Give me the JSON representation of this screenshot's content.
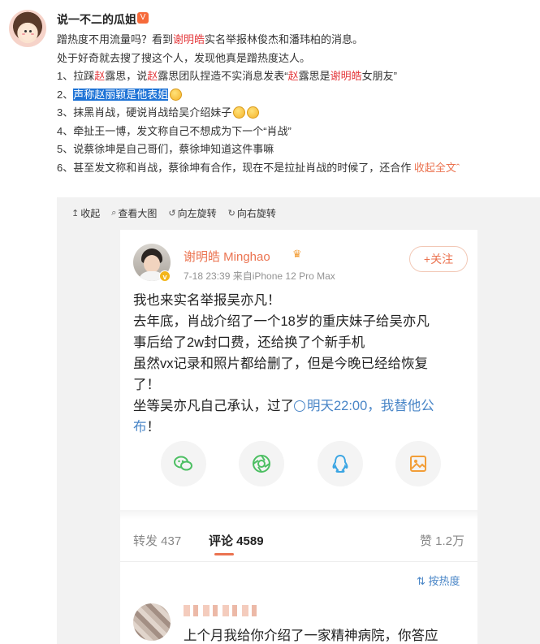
{
  "post": {
    "username": "说一不二的瓜姐",
    "badge": "V",
    "lines": [
      {
        "parts": [
          {
            "t": "蹭热度不用流量吗？看到"
          },
          {
            "t": "谢明皓",
            "c": "red"
          },
          {
            "t": "实名举报林俊杰和潘玮柏的消息。"
          }
        ]
      },
      {
        "parts": [
          {
            "t": "处于好奇就去搜了搜这个人，发现他真是蹭热度达人。"
          }
        ]
      },
      {
        "parts": [
          {
            "t": "1、拉踩"
          },
          {
            "t": "赵",
            "c": "red"
          },
          {
            "t": "露思，说"
          },
          {
            "t": "赵",
            "c": "red"
          },
          {
            "t": "露思团队捏造不实消息发表“"
          },
          {
            "t": "赵",
            "c": "red"
          },
          {
            "t": "露思是"
          },
          {
            "t": "谢明皓",
            "c": "red"
          },
          {
            "t": "女朋友”"
          }
        ]
      },
      {
        "parts": [
          {
            "t": "2、"
          },
          {
            "t": "声称赵丽颖是他表姐",
            "c": "sel"
          }
        ],
        "emoji": 1
      },
      {
        "parts": [
          {
            "t": "3、抹黑肖战，硬说肖战给吴介绍妹子"
          }
        ],
        "emoji": 2
      },
      {
        "parts": [
          {
            "t": "4、牵扯王一博，发文称自己不想成为下一个“肖战”"
          }
        ]
      },
      {
        "parts": [
          {
            "t": "5、说蔡徐坤是自己哥们，蔡徐坤知道这件事嘛"
          }
        ]
      },
      {
        "parts": [
          {
            "t": "6、甚至发文称和肖战，蔡徐坤有合作，现在不是拉扯肖战的时候了，还合作 "
          },
          {
            "t": "收起全文",
            "c": "link"
          },
          {
            "t": "ˆ",
            "c": "link"
          }
        ]
      }
    ]
  },
  "toolbar": {
    "collapse": "收起",
    "view_large": "查看大图",
    "rotate_left": "向左旋转",
    "rotate_right": "向右旋转"
  },
  "card": {
    "name": "谢明皓 Minghao",
    "meta": "7-18 23:39  来自iPhone 12 Pro Max",
    "follow": "+关注",
    "v": "v",
    "body": [
      "我也来实名举报吴亦凡！",
      "去年底，肖战介绍了一个18岁的重庆妹子给吴亦凡",
      "事后给了2w封口费，还给换了个新手机",
      "虽然vx记录和照片都给删了，但是今晚已经给恢复",
      "了！"
    ],
    "body_last_prefix": "坐等吴亦凡自己承认，过了",
    "body_last_blue": "明天22:00，我替他公",
    "body_last_line2_blue": "布",
    "body_last_line2_tail": "！",
    "share_icons": [
      "wechat-icon",
      "moments-icon",
      "qq-icon",
      "save-image-icon"
    ],
    "accent": "#eb7350"
  },
  "stats": {
    "repost": "转发 437",
    "comment": "评论 4589",
    "likes": "赞 1.2万",
    "sort": "按热度"
  },
  "comment": {
    "text": "上个月我给你介绍了一家精神病院，你答应"
  }
}
